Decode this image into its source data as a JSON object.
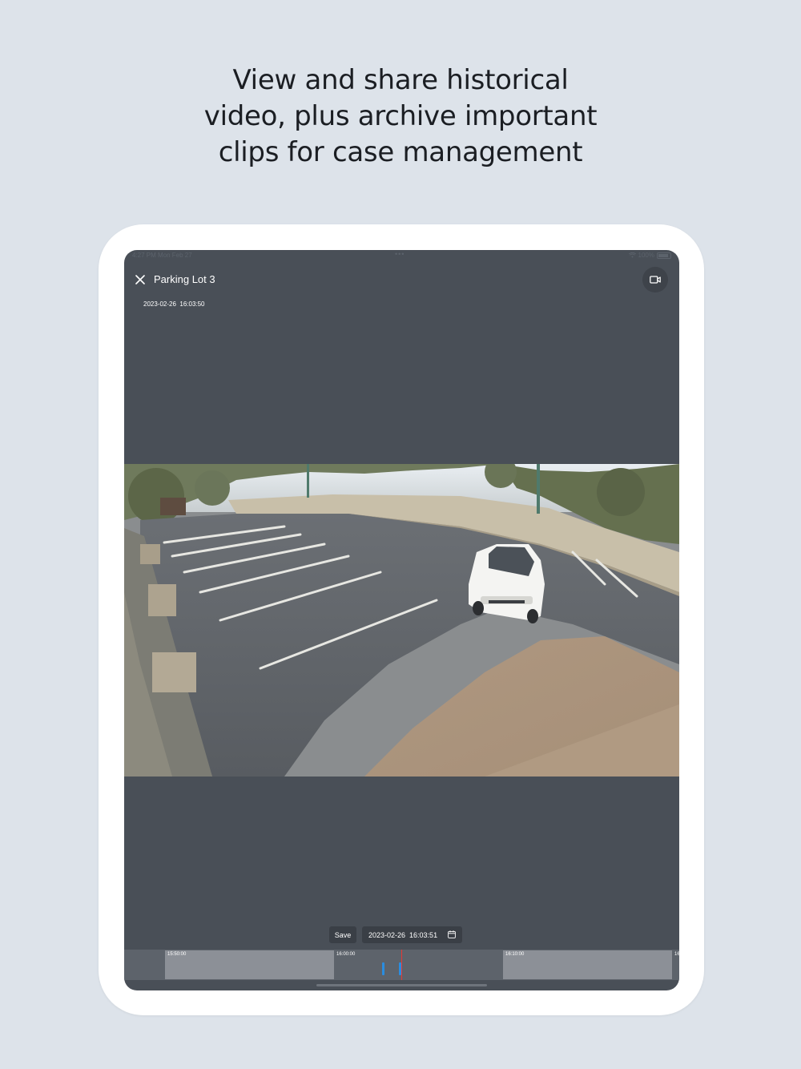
{
  "headline": {
    "line1": "View and share historical",
    "line2": "video, plus archive important",
    "line3": "clips for case management"
  },
  "status_bar": {
    "time": "4:27 PM  Mon Feb 27",
    "dots": "•••",
    "battery": "100%"
  },
  "viewer": {
    "camera_name": "Parking Lot 3",
    "overlay_timestamp": "2023-02-26  16:03:50",
    "camera_icon": "video-camera-icon",
    "close_icon": "close-icon"
  },
  "controls": {
    "save_label": "Save",
    "date_value": "2023-02-26  16:03:51",
    "calendar_icon": "calendar-icon"
  },
  "timeline": {
    "labels": [
      "15:50:00",
      "16:00:00",
      "16:10:00",
      "16"
    ],
    "accent_color": "#2a8de0",
    "cursor_color": "#e53935"
  },
  "colors": {
    "background": "#dde3ea",
    "screen": "#494f57"
  }
}
